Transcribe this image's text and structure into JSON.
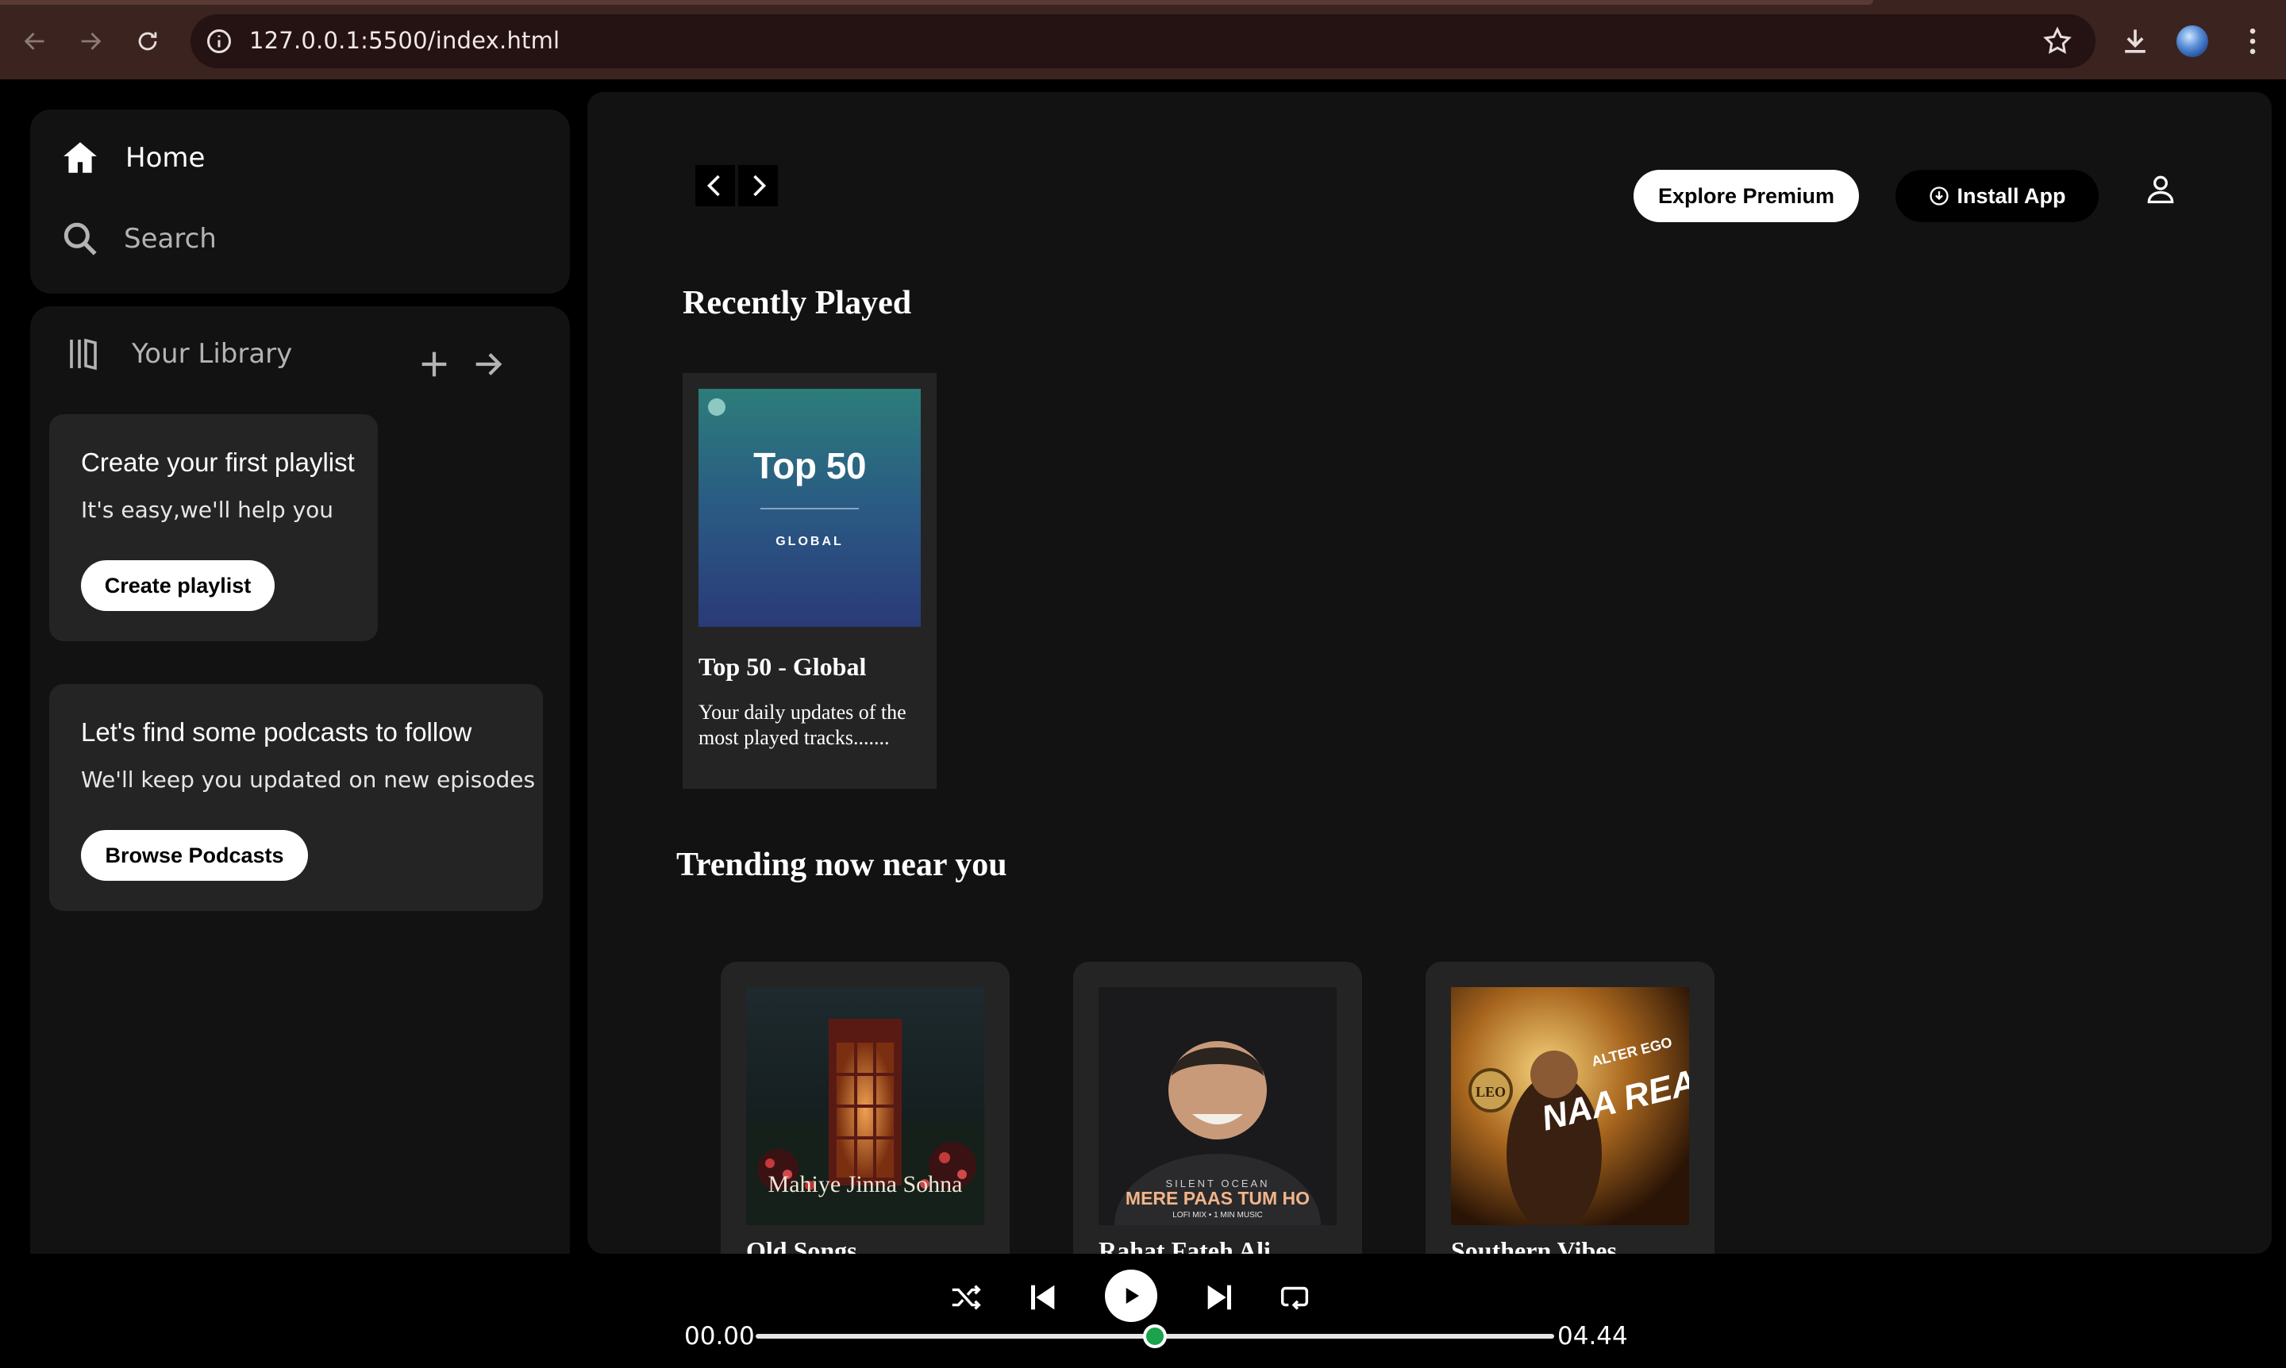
{
  "browser": {
    "url": "127.0.0.1:5500/index.html"
  },
  "sidebar": {
    "nav": [
      {
        "label": "Home",
        "icon": "home-icon"
      },
      {
        "label": "Search",
        "icon": "search-icon"
      }
    ],
    "library": {
      "label": "Your Library",
      "icon": "library-icon"
    },
    "playlist_card": {
      "title": "Create your first playlist",
      "subtitle": "It's easy,we'll help you",
      "button": "Create playlist"
    },
    "podcast_card": {
      "title": "Let's find some podcasts to follow",
      "subtitle": "We'll keep you updated on new episodes",
      "button": "Browse Podcasts"
    }
  },
  "header": {
    "explore_label": "Explore Premium",
    "install_label": "Install App"
  },
  "recently_played": {
    "heading": "Recently Played",
    "items": [
      {
        "cover_big": "Top 50",
        "cover_small": "GLOBAL",
        "title": "Top 50 - Global",
        "description": "Your daily updates of the most played tracks......."
      }
    ]
  },
  "trending": {
    "heading": "Trending now near you",
    "items": [
      {
        "title": "Old Songs",
        "cover_text": "Mahiye Jinna Sohna"
      },
      {
        "title": "Rahat Fateh Ali",
        "cover_text": "MERE PAAS TUM HO",
        "cover_sub": "SILENT OCEAN",
        "cover_sub2": "LOFI MIX • 1 MIN MUSIC"
      },
      {
        "title": "Southern Vibes",
        "cover_text": "NAA READY",
        "cover_sub": "ALTER EGO",
        "cover_badge": "LEO"
      }
    ]
  },
  "player": {
    "time_current": "00.00",
    "time_total": "04.44",
    "progress_fraction": 0.5
  },
  "colors": {
    "background": "#000000",
    "panel": "#121212",
    "card": "#242424",
    "accent": "#1aa34a",
    "chrome": "#3b2320"
  }
}
